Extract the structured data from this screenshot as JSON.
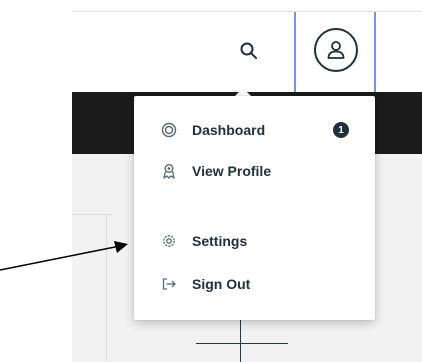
{
  "header": {
    "search_icon": "search-icon",
    "account_icon": "user-icon"
  },
  "menu": {
    "items": [
      {
        "label": "Dashboard",
        "icon": "dashboard-icon",
        "badge": "1"
      },
      {
        "label": "View Profile",
        "icon": "profile-icon"
      },
      {
        "label": "Settings",
        "icon": "gear-icon"
      },
      {
        "label": "Sign Out",
        "icon": "sign-out-icon"
      }
    ]
  },
  "annotation": {
    "arrow_target": "Settings"
  },
  "colors": {
    "focus_border": "#6f97f0",
    "dark_bar": "#1b1b1b",
    "text": "#20303d",
    "icon": "#5a6874",
    "badge": "#1f2f3c"
  }
}
